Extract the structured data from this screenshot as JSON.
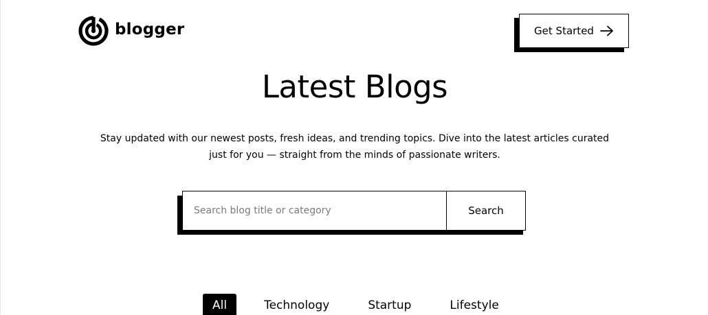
{
  "brand": {
    "name": "blogger",
    "icon": "target-logo-icon"
  },
  "header": {
    "cta_label": "Get Started",
    "cta_icon": "arrow-right-icon"
  },
  "hero": {
    "title": "Latest Blogs",
    "subtitle": "Stay updated with our newest posts, fresh ideas, and trending topics. Dive into the latest articles curated just for you — straight from the minds of passionate writers."
  },
  "search": {
    "value": "",
    "placeholder": "Search blog title or category",
    "button_label": "Search"
  },
  "categories": {
    "selected": "All",
    "items": [
      "All",
      "Technology",
      "Startup",
      "Lifestyle"
    ]
  },
  "colors": {
    "background": "#ffffff",
    "text": "#000000",
    "placeholder": "#7a7a7a",
    "shadow": "#000000"
  }
}
